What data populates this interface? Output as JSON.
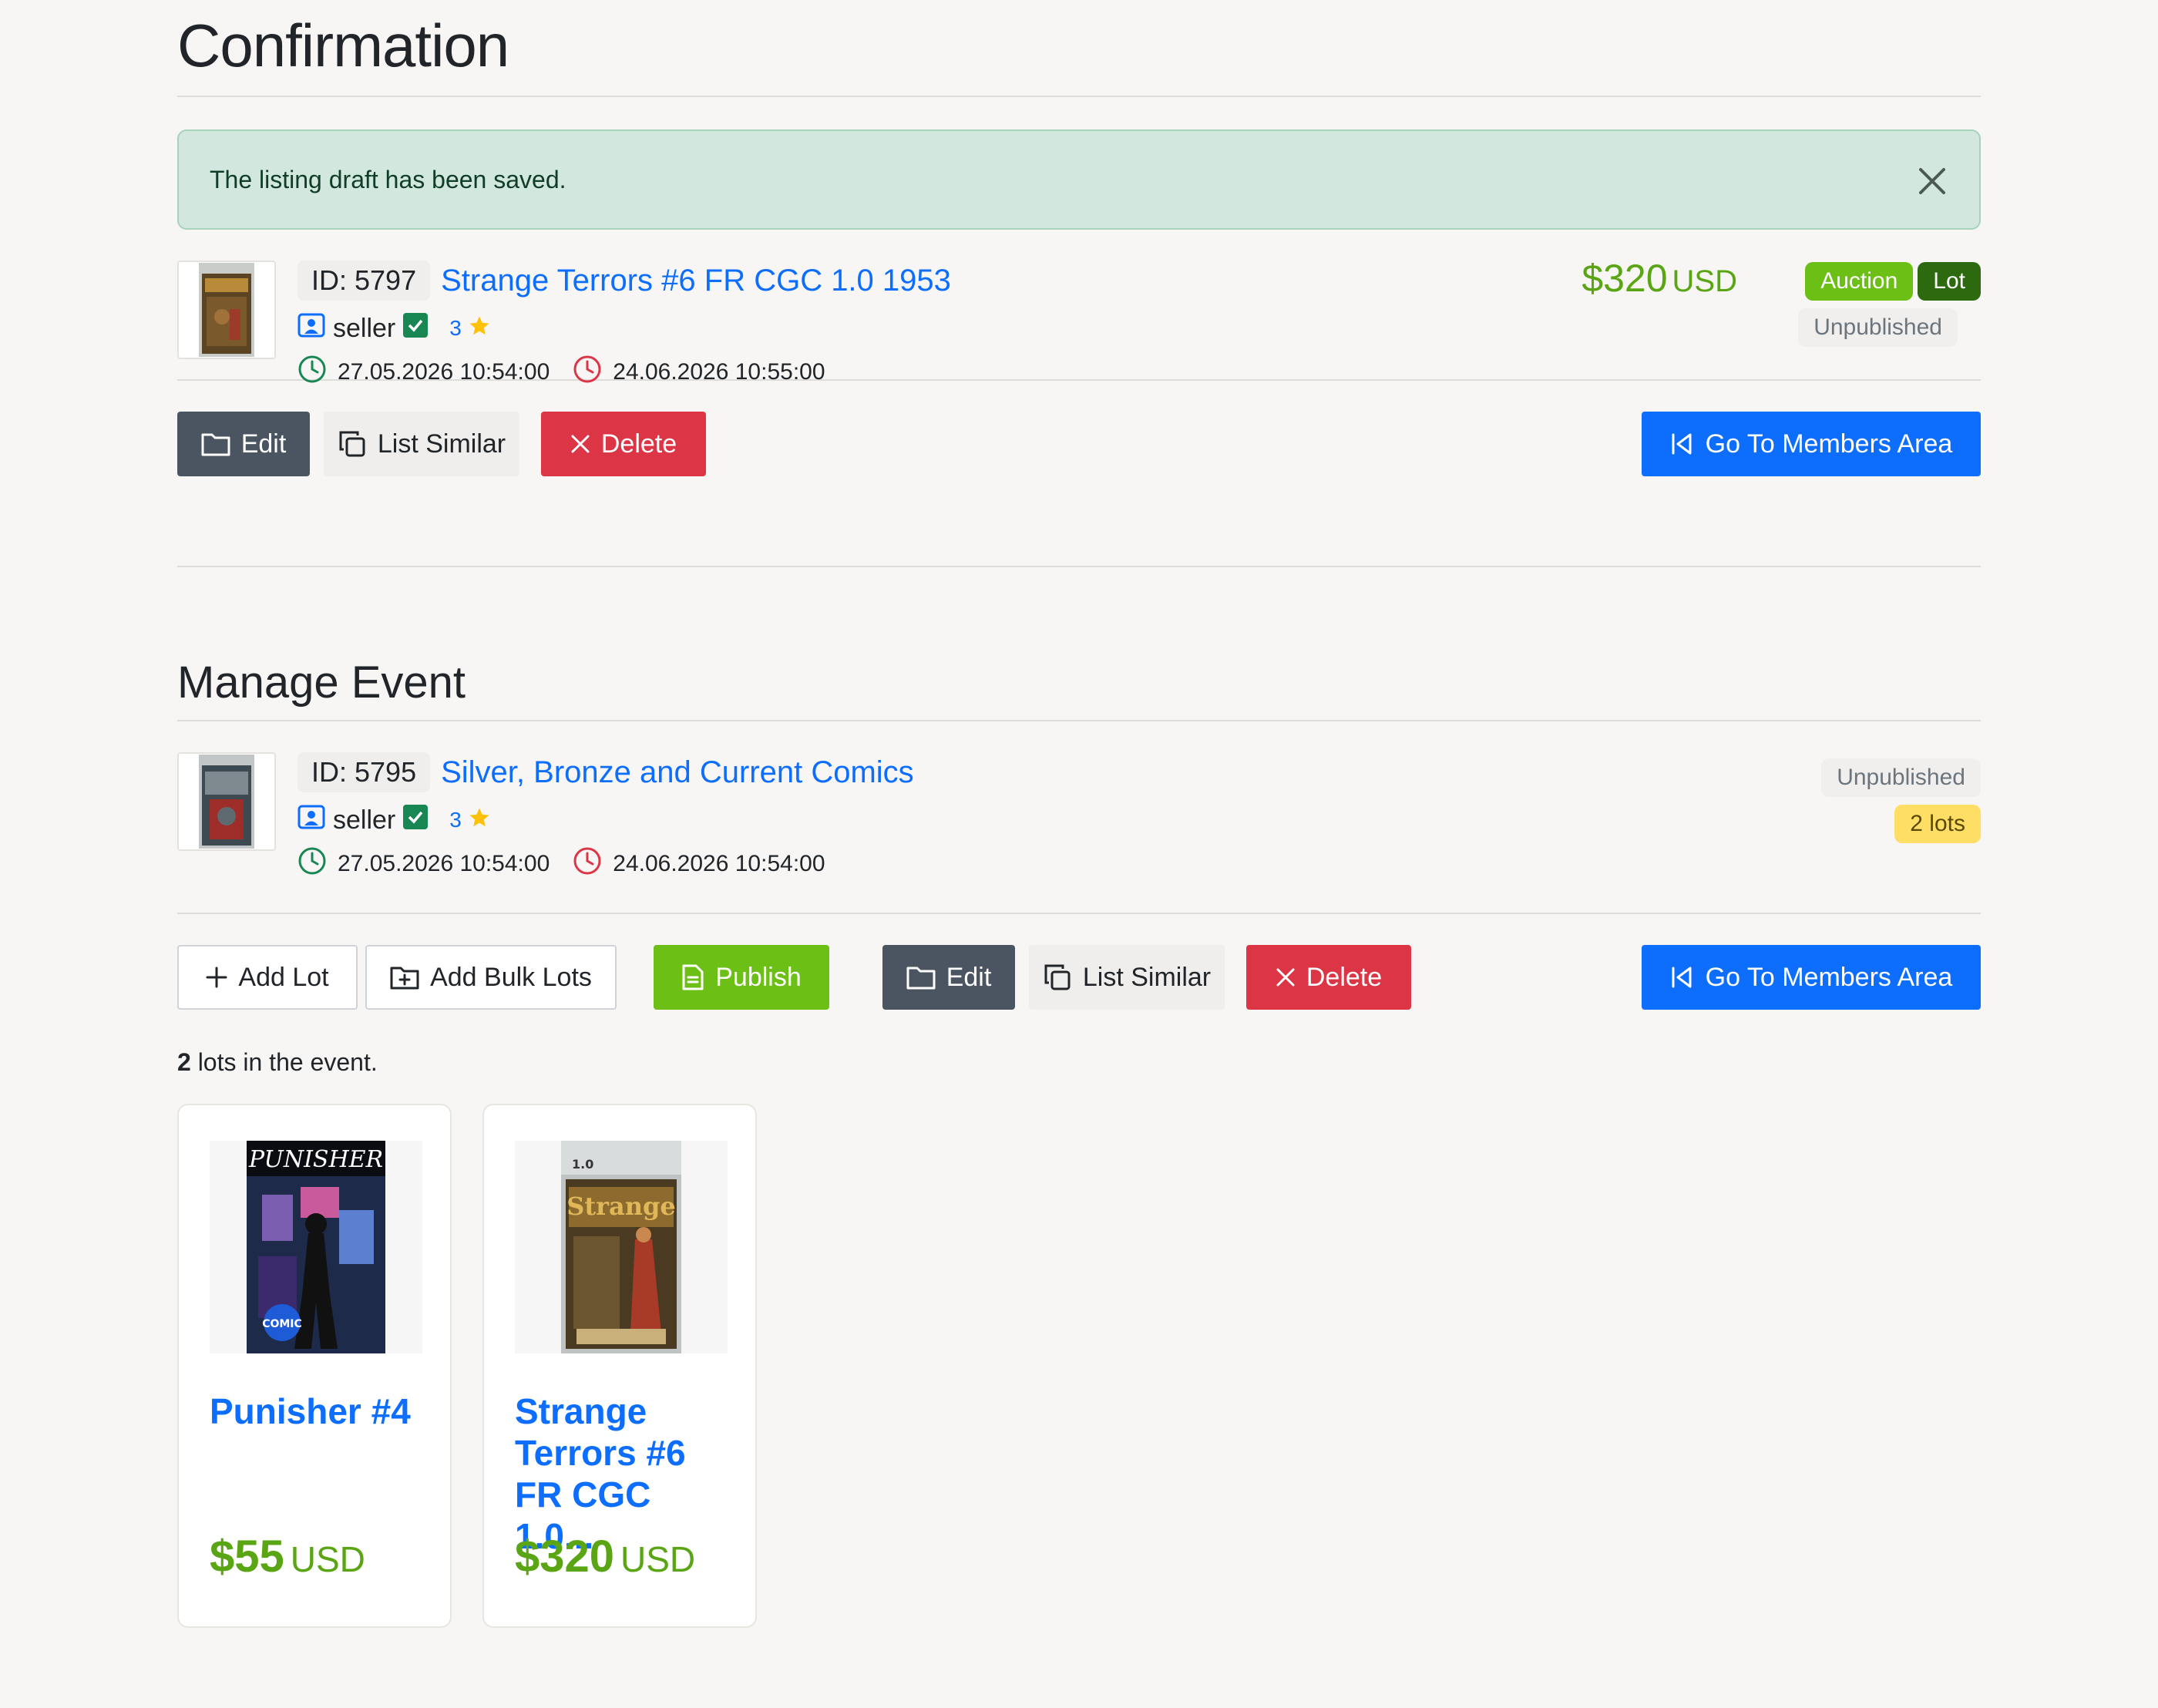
{
  "confirmation": {
    "title": "Confirmation",
    "alert_text": "The listing draft has been saved.",
    "listing": {
      "id_label": "ID: 5797",
      "title": "Strange Terrors #6 FR CGC 1.0 1953",
      "seller": "seller",
      "rating": "3",
      "start": "27.05.2026 10:54:00",
      "end": "24.06.2026 10:55:00",
      "price": "$320",
      "currency": "USD",
      "badge_auction": "Auction",
      "badge_lot": "Lot",
      "status": "Unpublished"
    },
    "buttons": {
      "edit": "Edit",
      "list_similar": "List Similar",
      "delete": "Delete",
      "members": "Go To Members Area"
    }
  },
  "manage_event": {
    "title": "Manage Event",
    "event": {
      "id_label": "ID: 5795",
      "title": "Silver, Bronze and Current Comics",
      "seller": "seller",
      "rating": "3",
      "start": "27.05.2026 10:54:00",
      "end": "24.06.2026 10:54:00",
      "status": "Unpublished",
      "lots_badge": "2 lots"
    },
    "buttons": {
      "add_lot": "Add Lot",
      "add_bulk": "Add Bulk Lots",
      "publish": "Publish",
      "edit": "Edit",
      "list_similar": "List Similar",
      "delete": "Delete",
      "members": "Go To Members Area"
    },
    "lots_count_num": "2",
    "lots_count_text": "lots in the event.",
    "lots": [
      {
        "title": "Punisher #4",
        "price": "$55",
        "currency": "USD"
      },
      {
        "title": "Strange Terrors #6 FR CGC 1.0...",
        "price": "$320",
        "currency": "USD"
      }
    ]
  },
  "colors": {
    "link": "#0d6efd",
    "price": "#5aa513",
    "danger": "#dc3545",
    "success_alert": "#d2e7dd"
  }
}
